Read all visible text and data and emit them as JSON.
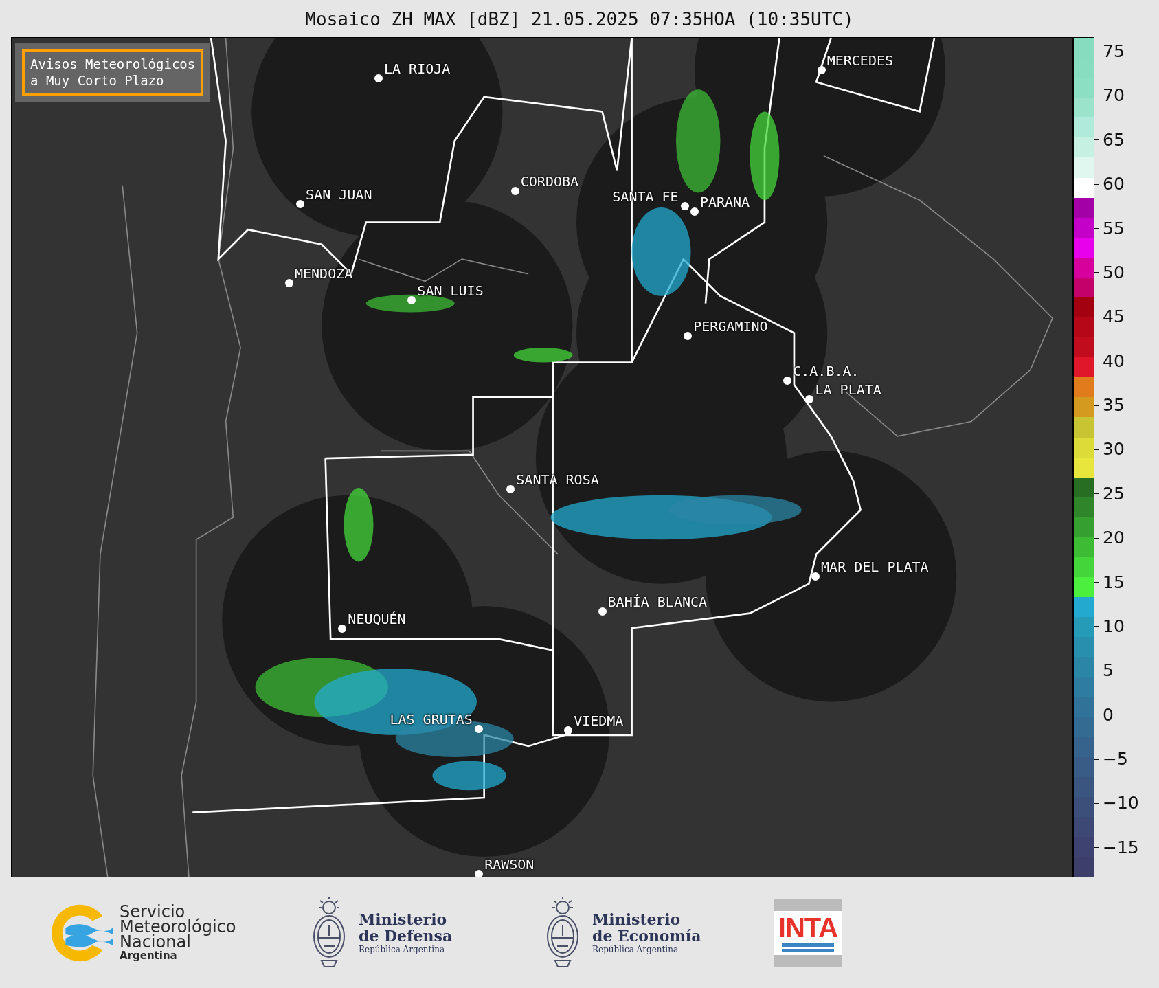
{
  "title": "Mosaico ZH MAX [dBZ] 21.05.2025 07:35HOA (10:35UTC)",
  "notice": {
    "text": "Avisos Meteorológicos\na Muy Corto Plazo"
  },
  "cities": [
    {
      "name": "LA RIOJA"
    },
    {
      "name": "MERCEDES"
    },
    {
      "name": "CORDOBA"
    },
    {
      "name": "SAN JUAN"
    },
    {
      "name": "SANTA FE"
    },
    {
      "name": "PARANA"
    },
    {
      "name": "MENDOZA"
    },
    {
      "name": "SAN LUIS"
    },
    {
      "name": "PERGAMINO"
    },
    {
      "name": "C.A.B.A."
    },
    {
      "name": "LA PLATA"
    },
    {
      "name": "SANTA ROSA"
    },
    {
      "name": "MAR DEL PLATA"
    },
    {
      "name": "BAHÍA BLANCA"
    },
    {
      "name": "NEUQUÉN"
    },
    {
      "name": "LAS GRUTAS"
    },
    {
      "name": "VIEDMA"
    },
    {
      "name": "RAWSON"
    }
  ],
  "colorbar": {
    "segments": [
      {
        "color": "#86dcbf"
      },
      {
        "color": "#88ddc0"
      },
      {
        "color": "#8ddfc3"
      },
      {
        "color": "#9ce3cc"
      },
      {
        "color": "#b0eadb"
      },
      {
        "color": "#c6f0e2"
      },
      {
        "color": "#dff7ef"
      },
      {
        "color": "#ffffff"
      },
      {
        "color": "#a300a8"
      },
      {
        "color": "#c400c8"
      },
      {
        "color": "#e800ec"
      },
      {
        "color": "#d6009c"
      },
      {
        "color": "#c4006a"
      },
      {
        "color": "#a30010"
      },
      {
        "color": "#b40818"
      },
      {
        "color": "#c10c1e"
      },
      {
        "color": "#e0162a"
      },
      {
        "color": "#e07c1c"
      },
      {
        "color": "#d49a20"
      },
      {
        "color": "#c8c532"
      },
      {
        "color": "#dcdc38"
      },
      {
        "color": "#e8e53c"
      },
      {
        "color": "#276e22"
      },
      {
        "color": "#2f852a"
      },
      {
        "color": "#359f2f"
      },
      {
        "color": "#3dbb35"
      },
      {
        "color": "#44d53a"
      },
      {
        "color": "#4cef3e"
      },
      {
        "color": "#23a9cf"
      },
      {
        "color": "#259bb7"
      },
      {
        "color": "#2890ae"
      },
      {
        "color": "#2b86a6"
      },
      {
        "color": "#2e7c9f"
      },
      {
        "color": "#317398"
      },
      {
        "color": "#346b92"
      },
      {
        "color": "#36638c"
      },
      {
        "color": "#385c86"
      },
      {
        "color": "#3a557f"
      },
      {
        "color": "#3c4e7a"
      },
      {
        "color": "#3d4874"
      },
      {
        "color": "#3e4270"
      },
      {
        "color": "#3e3e6a"
      }
    ],
    "ticks": [
      "75",
      "70",
      "65",
      "60",
      "55",
      "50",
      "45",
      "40",
      "35",
      "30",
      "25",
      "20",
      "15",
      "10",
      "5",
      "0",
      "−5",
      "−10",
      "−15"
    ]
  },
  "logos": [
    {
      "kind": "smn",
      "lines": [
        "Servicio",
        "Meteorológico",
        "Nacional"
      ],
      "sub": "Argentina"
    },
    {
      "kind": "ministry",
      "lines": [
        "Ministerio",
        "de Defensa"
      ],
      "sub": "República Argentina"
    },
    {
      "kind": "ministry",
      "lines": [
        "Ministerio",
        "de Economía"
      ],
      "sub": "República Argentina"
    },
    {
      "kind": "inta",
      "lines": [
        "INTA"
      ]
    }
  ]
}
